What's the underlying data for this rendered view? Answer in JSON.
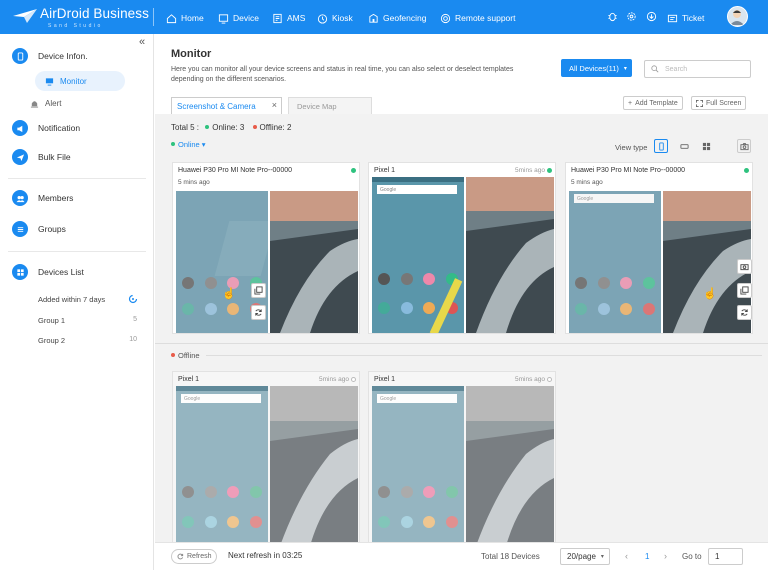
{
  "app": {
    "brand": "AirDroid Business",
    "sub": "Sand Studio"
  },
  "nav": {
    "home": "Home",
    "device": "Device",
    "ams": "AMS",
    "kiosk": "Kiosk",
    "geofencing": "Geofencing",
    "remote": "Remote support",
    "ticket": "Ticket"
  },
  "sidebar": {
    "device_info": "Device Infon.",
    "monitor": "Monitor",
    "alert": "Alert",
    "notification": "Notification",
    "bulk_file": "Bulk File",
    "members": "Members",
    "groups": "Groups",
    "devices_list": "Devices List",
    "list": [
      {
        "label": "Added within 7 days",
        "count": ""
      },
      {
        "label": "Group 1",
        "count": "5"
      },
      {
        "label": "Group 2",
        "count": "10"
      }
    ]
  },
  "header": {
    "title": "Monitor",
    "desc": "Here you can monitor all your device screens and status in real time, you can also select or deselect templates depending on the different scenarios.",
    "all_devices": "All Devices(11)",
    "search_placeholder": "Search"
  },
  "tabs": {
    "screenshot": "Screenshot & Camera",
    "map": "Device Map",
    "add_template": "Add Template",
    "full_screen": "Full Screen"
  },
  "stats": {
    "total": "Total 5 :",
    "online": "Online: 3",
    "offline": "Offline: 2"
  },
  "sections": {
    "online": "Online",
    "offline": "Offline",
    "view_type": "View type"
  },
  "cards": [
    {
      "name": "Huawei P30 Pro MI Note Pro--00000",
      "time": "5 mins ago",
      "right": ""
    },
    {
      "name": "Pixel 1",
      "time": "",
      "right": "5mins ago"
    },
    {
      "name": "Huawei P30 Pro MI Note Pro--00000",
      "time": "5 mins ago",
      "right": ""
    },
    {
      "name": "Pixel 1",
      "time": "",
      "right": "5mins ago"
    },
    {
      "name": "Pixel 1",
      "time": "",
      "right": "5mins ago"
    }
  ],
  "footer": {
    "refresh": "Refresh",
    "next": "Next refresh in 03:25",
    "total": "Total 18 Devices",
    "per_page": "20/page",
    "page": "1",
    "goto": "Go to",
    "goto_val": "1"
  },
  "colors": {
    "primary": "#1a8af0",
    "online": "#2ec27e",
    "offline": "#e85c4a"
  }
}
